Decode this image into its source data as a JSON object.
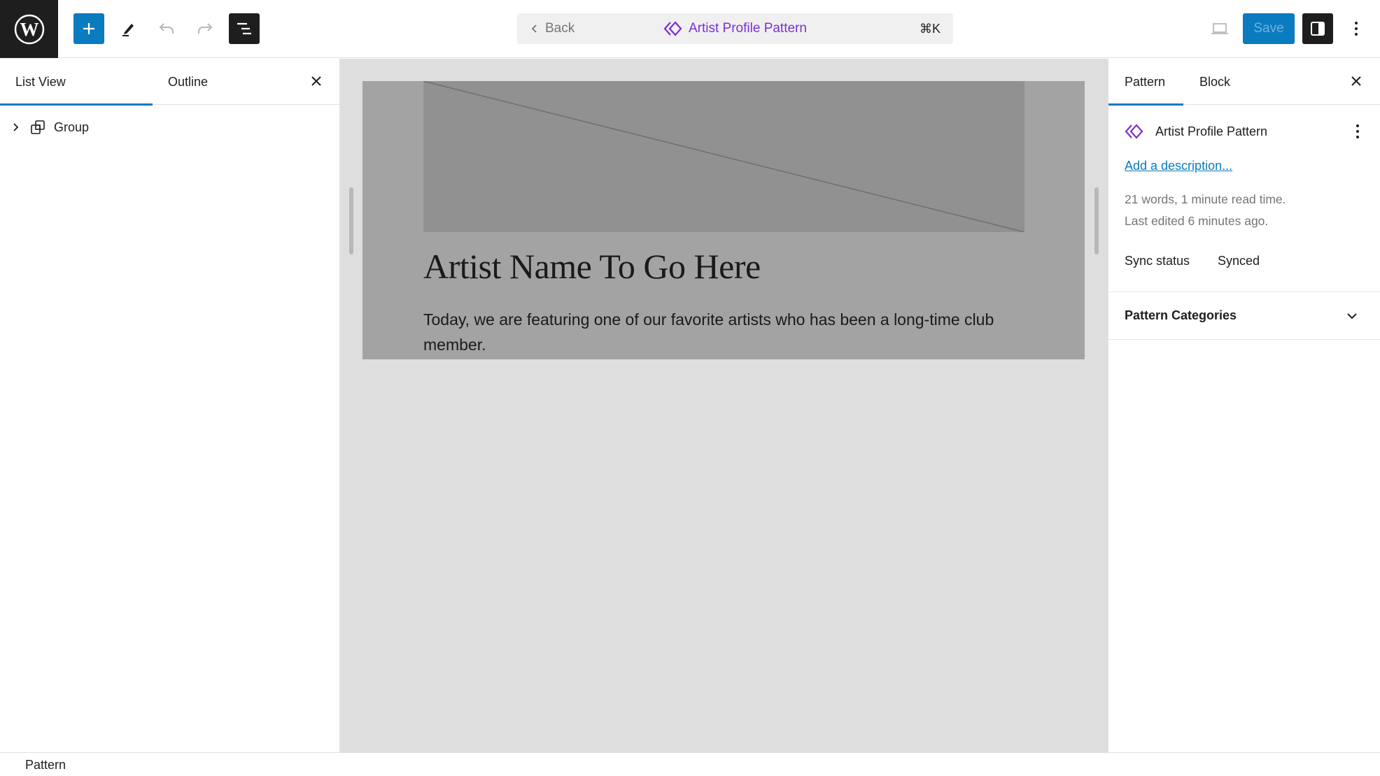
{
  "header": {
    "logo_icon": "wordpress-logo-icon",
    "toolbar": {
      "add_block_icon": "plus-icon",
      "tools_icon": "pen-icon",
      "undo_icon": "undo-icon",
      "redo_icon": "redo-icon",
      "list_view_icon": "list-view-icon"
    },
    "command_bar": {
      "back_label": "Back",
      "title": "Artist Profile Pattern",
      "title_icon": "symbol-diamond-icon",
      "shortcut": "⌘K"
    },
    "device_preview_icon": "laptop-icon",
    "save_label": "Save",
    "settings_icon": "sidebar-icon",
    "options_icon": "more-vertical-icon"
  },
  "left_panel": {
    "tabs": [
      {
        "label": "List View",
        "active": true
      },
      {
        "label": "Outline",
        "active": false
      }
    ],
    "close_icon": "close-icon",
    "list_items": [
      {
        "label": "Group",
        "icon": "group-icon",
        "expanded": false
      }
    ]
  },
  "canvas": {
    "image_placeholder": "image-placeholder",
    "heading": "Artist Name To Go Here",
    "paragraph": "Today, we are featuring one of our favorite artists who has been a long-time club member."
  },
  "right_panel": {
    "tabs": [
      {
        "label": "Pattern",
        "active": true
      },
      {
        "label": "Block",
        "active": false
      }
    ],
    "close_icon": "close-icon",
    "pattern": {
      "title": "Artist Profile Pattern",
      "add_description": "Add a description...",
      "word_count": "21 words, 1 minute read time.",
      "last_edited": "Last edited 6 minutes ago.",
      "sync_status_label": "Sync status",
      "sync_status_value": "Synced"
    },
    "categories_label": "Pattern Categories"
  },
  "footer": {
    "breadcrumb": "Pattern"
  },
  "colors": {
    "accent": "#0a7bbf",
    "pattern_purple": "#7e2ed4",
    "dark": "#1e1e1e"
  }
}
